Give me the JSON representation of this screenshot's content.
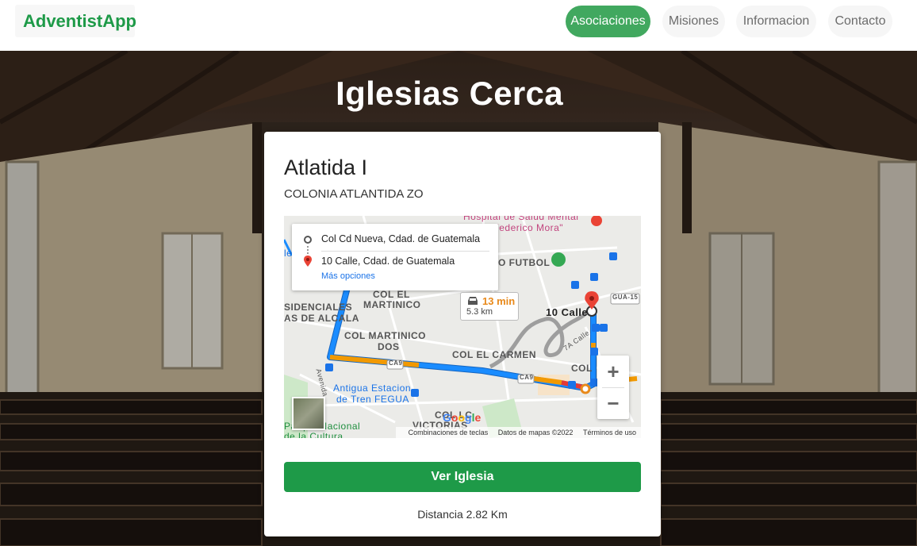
{
  "navbar": {
    "brand": "AdventistApp",
    "items": [
      {
        "label": "Asociaciones",
        "active": true
      },
      {
        "label": "Misiones",
        "active": false
      },
      {
        "label": "Informacion",
        "active": false
      },
      {
        "label": "Contacto",
        "active": false
      }
    ]
  },
  "hero": {
    "title": "Iglesias Cerca"
  },
  "card": {
    "church_name": "Atlatida I",
    "address": "COLONIA ATLANTIDA ZO",
    "button_label": "Ver Iglesia",
    "distance": "Distancia 2.82 Km"
  },
  "map": {
    "directions": {
      "origin": "Col Cd Nueva, Cdad. de Guatemala",
      "destination": "10 Calle, Cdad. de Guatemala",
      "more_options": "Más opciones"
    },
    "eta": {
      "time": "13 min",
      "distance": "5.3 km"
    },
    "zoom_in": "+",
    "zoom_out": "−",
    "google": "Google",
    "footer": {
      "shortcuts": "Combinaciones de teclas",
      "data": "Datos de mapas ©2022",
      "terms": "Términos de uso"
    },
    "labels": {
      "hospital": "Hospital de Salud Mental",
      "hospital2": "\"Dr. Federico Mora\"",
      "futbol": "O FUTBOL",
      "col_el_martinico": "COL EL",
      "col_el_martinico2": "MARTINICO",
      "residenciales": "SIDENCIALES",
      "alcala": "AS DE ALCALA",
      "martinico_dos": "COL MARTINICO",
      "martinico_dos2": "DOS",
      "el_carmen": "COL EL CARMEN",
      "ca9a": "CA9",
      "ca9b": "CA9",
      "gua15": "GUA-15",
      "dest_label": "10 Calle",
      "col_right": "COL",
      "estacion": "Antigua Estacion",
      "estacion2": "de Tren FEGUA",
      "victorias": "COL LC",
      "victorias2": "VICTORIAS",
      "parque": "Parque Nacional",
      "parque2": "de la Cultura",
      "avenida": "Avenida",
      "calle7a": "7A Calle",
      "left_le": "le"
    }
  },
  "colors": {
    "brand": "#1e9a48",
    "nav_active": "#41a85f",
    "button": "#1e9a48",
    "route_blue": "#1a8cff",
    "route_orange": "#f29900",
    "route_red": "#e53935",
    "pin_red": "#ea4335"
  },
  "icons": {
    "origin": "circle-origin-icon",
    "destination": "map-pin-icon",
    "car": "car-icon",
    "bus_stop": "bus-stop-icon",
    "hospital": "hospital-icon",
    "park": "park-pin-icon"
  }
}
